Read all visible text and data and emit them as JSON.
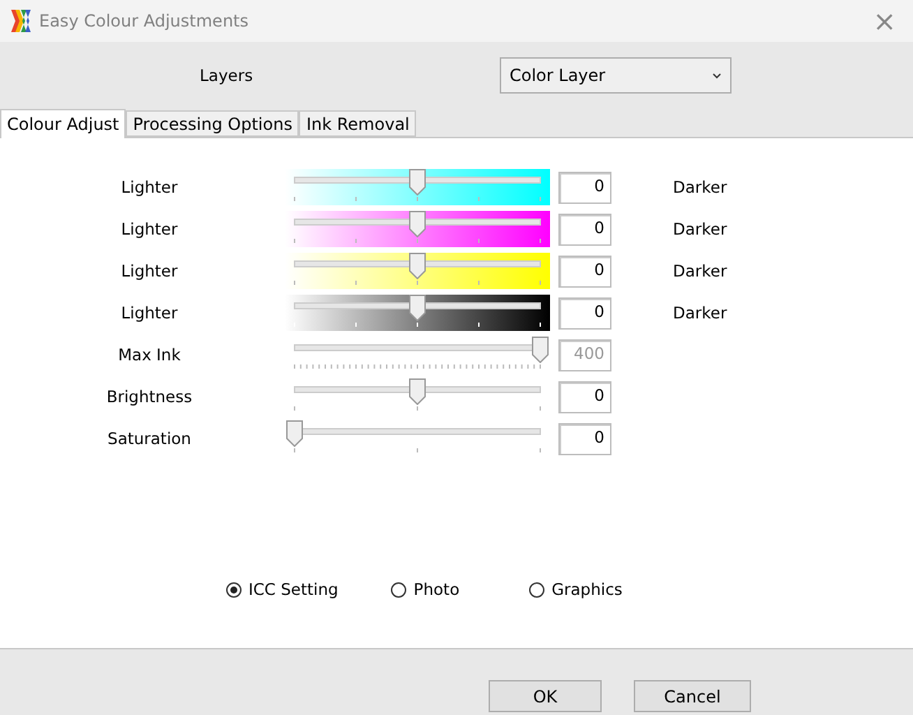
{
  "window": {
    "title": "Easy Colour Adjustments",
    "close": "×"
  },
  "layers": {
    "label": "Layers",
    "value": "Color Layer"
  },
  "tabs": [
    {
      "label": "Colour Adjust",
      "selected": true
    },
    {
      "label": "Processing Options",
      "selected": false
    },
    {
      "label": "Ink Removal",
      "selected": false
    }
  ],
  "sliders": [
    {
      "kind": "gradient",
      "label": "Lighter",
      "color": "#00ffff",
      "level": 0.5,
      "value": "0",
      "end_label": "Darker"
    },
    {
      "kind": "gradient",
      "label": "Lighter",
      "color": "#ff00ff",
      "level": 0.5,
      "value": "0",
      "end_label": "Darker"
    },
    {
      "kind": "gradient",
      "label": "Lighter",
      "color": "#ffff00",
      "level": 0.5,
      "value": "0",
      "end_label": "Darker"
    },
    {
      "kind": "gradient",
      "label": "Lighter",
      "color": "#000000",
      "level": 0.5,
      "value": "0",
      "end_label": "Darker"
    },
    {
      "kind": "fine",
      "label": "Max Ink",
      "level": 1,
      "value": "400",
      "disabled": true
    },
    {
      "kind": "plain",
      "label": "Brightness",
      "level": 0.5,
      "value": "0",
      "disabled": false
    },
    {
      "kind": "plain",
      "label": "Saturation",
      "level": 0,
      "value": "0",
      "disabled": false
    }
  ],
  "modes": [
    {
      "label": "ICC Setting",
      "selected": true
    },
    {
      "label": "Photo",
      "selected": false
    },
    {
      "label": "Graphics",
      "selected": false
    }
  ],
  "buttons": [
    "OK",
    "Cancel"
  ]
}
